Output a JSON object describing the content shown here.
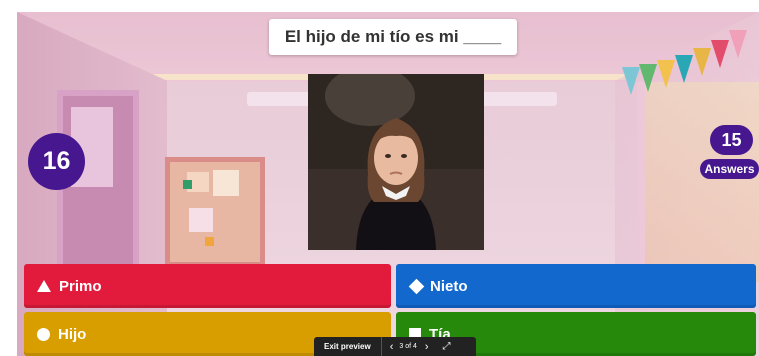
{
  "question": {
    "text": "El hijo de mi tío es mi ____"
  },
  "timer": {
    "value": "16"
  },
  "answers_count": {
    "value": "15",
    "label": "Answers"
  },
  "answers": [
    {
      "label": "Primo",
      "color": "#e21b3c",
      "shape": "triangle-icon"
    },
    {
      "label": "Nieto",
      "color": "#1368ce",
      "shape": "diamond-icon"
    },
    {
      "label": "Hijo",
      "color": "#d89e00",
      "shape": "circle-icon"
    },
    {
      "label": "Tía",
      "color": "#26890c",
      "shape": "square-icon"
    }
  ],
  "preview_bar": {
    "exit_label": "Exit preview",
    "page_label": "3 of 4"
  },
  "colors": {
    "purple": "#46178f"
  }
}
